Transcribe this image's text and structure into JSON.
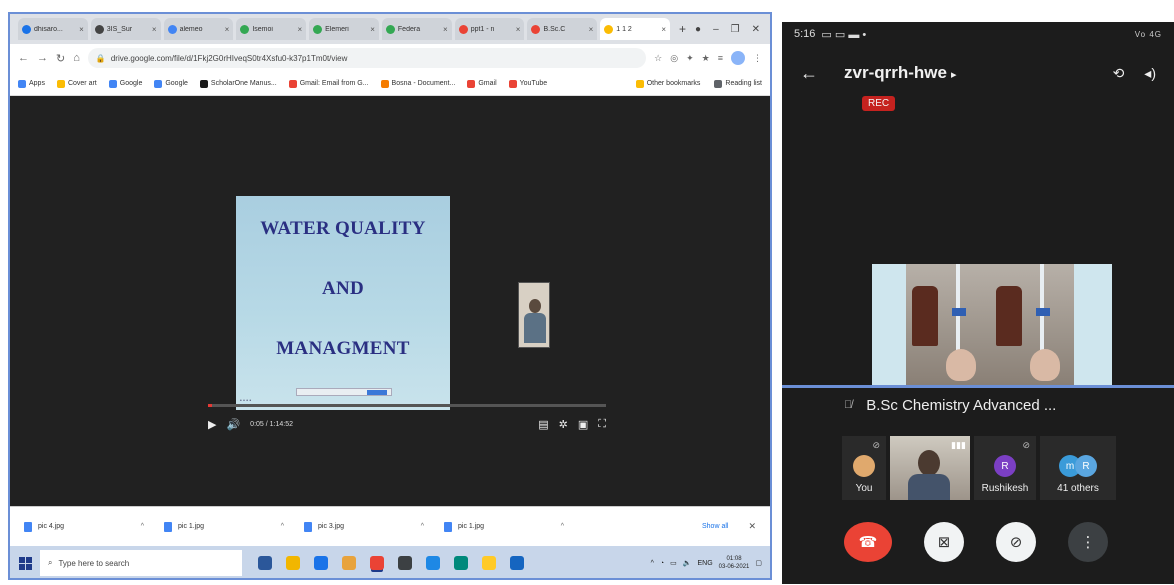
{
  "desktop": {
    "tabs": [
      {
        "label": "dhisaro...",
        "color": "#1a73e8"
      },
      {
        "label": "3IS_Sur",
        "color": "#444444"
      },
      {
        "label": "alemeo",
        "color": "#4285f4"
      },
      {
        "label": "Isemoi",
        "color": "#34a853"
      },
      {
        "label": "Elemeri",
        "color": "#34a853"
      },
      {
        "label": "Federa",
        "color": "#34a853"
      },
      {
        "label": "ppt1 - n",
        "color": "#ea4335"
      },
      {
        "label": "B.Sc.C",
        "color": "#ea4335"
      },
      {
        "label": "1 1 2",
        "color": "#fbbc04"
      }
    ],
    "new_tab": "+",
    "url": "drive.google.com/file/d/1Fkj2G0rHIveqS0tr4Xsfu0-k37p1Tm0t/view",
    "bookmarks": [
      {
        "label": "Apps",
        "color": "#4285f4"
      },
      {
        "label": "Cover art",
        "color": "#fbbc04"
      },
      {
        "label": "Google",
        "color": "#4285f4"
      },
      {
        "label": "Google",
        "color": "#4285f4"
      },
      {
        "label": "ScholarOne Manus...",
        "color": "#1a1a1a"
      },
      {
        "label": "Gmail: Email from G...",
        "color": "#ea4335"
      },
      {
        "label": "Bosna - Document...",
        "color": "#f57c00"
      },
      {
        "label": "Gmail",
        "color": "#ea4335"
      },
      {
        "label": "YouTube",
        "color": "#ea4335"
      }
    ],
    "other_bookmarks": "Other bookmarks",
    "reading_list": "Reading list",
    "slide": {
      "line1": "WATER QUALITY",
      "line2": "AND",
      "line3": "MANAGMENT"
    },
    "video": {
      "time": "0:05 / 1:14:52",
      "progress": 0.01
    },
    "downloads": [
      {
        "label": "pic 4.jpg"
      },
      {
        "label": "pic 1.jpg"
      },
      {
        "label": "pic 3.jpg"
      },
      {
        "label": "pic 1.jpg"
      }
    ],
    "show_all": "Show all",
    "search_placeholder": "Type here to search",
    "taskbar_apps": [
      "#2b579a",
      "#f2b600",
      "#1a73e8",
      "#e8a33d",
      "#ea4335",
      "#3c4043",
      "#1e88e5",
      "#00897b",
      "#ffca28",
      "#1565c0"
    ],
    "tray": {
      "lang": "ENG",
      "time": "01:08",
      "date": "03-06-2021"
    }
  },
  "phone": {
    "status_time": "5:16",
    "status_right": "Vo 4G",
    "meeting_code": "zvr-qrrh-hwe",
    "rec_label": "REC",
    "meeting_title": "B.Sc Chemistry Advanced ...",
    "participants": {
      "you": "You",
      "rushikesh_initial": "R",
      "rushikesh": "Rushikesh",
      "others_initial_1": "m",
      "others_initial_2": "R",
      "others": "41 others"
    }
  }
}
